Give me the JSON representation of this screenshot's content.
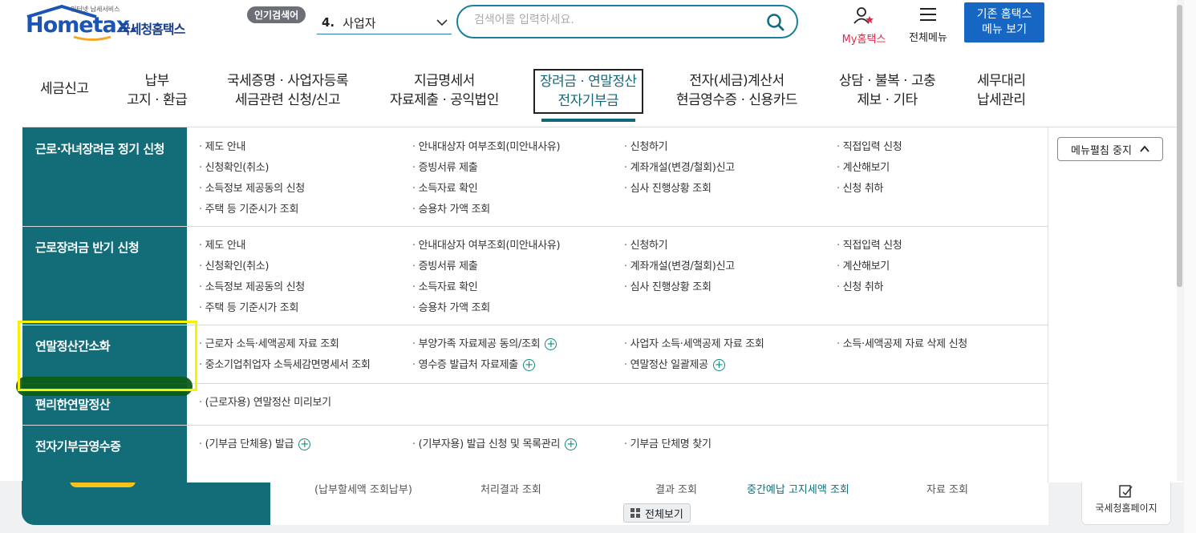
{
  "header": {
    "logo_small": "인터넷 납세서비스",
    "logo_main": "Hometax.",
    "logo_sub": "국세청홈택스",
    "popular_badge": "인기검색어",
    "popular_rank": "4.",
    "popular_term": "사업자",
    "search_placeholder": "검색어를 입력하세요.",
    "myhome_label": "My홈택스",
    "allmenu_label": "전체메뉴",
    "legacy_line1": "기존 홈택스",
    "legacy_line2": "메뉴 보기"
  },
  "gnb": [
    {
      "line1": "세금신고",
      "line2": ""
    },
    {
      "line1": "납부",
      "line2": "고지 · 환급"
    },
    {
      "line1": "국세증명 · 사업자등록",
      "line2": "세금관련 신청/신고"
    },
    {
      "line1": "지급명세서",
      "line2": "자료제출 · 공익법인"
    },
    {
      "line1": "장려금 · 연말정산",
      "line2": "전자기부금"
    },
    {
      "line1": "전자(세금)계산서",
      "line2": "현금영수증 · 신용카드"
    },
    {
      "line1": "상담 · 불복 · 고충",
      "line2": "제보 · 기타"
    },
    {
      "line1": "세무대리",
      "line2": "납세관리"
    }
  ],
  "menu_stop": "메뉴펼침 중지",
  "sections": [
    {
      "title": "근로·자녀장려금 정기 신청",
      "links": [
        [
          "제도 안내",
          "안내대상자 여부조회(미안내사유)",
          "신청하기",
          "직접입력 신청"
        ],
        [
          "신청확인(취소)",
          "증빙서류 제출",
          "계좌개설(변경/철회)신고",
          "계산해보기"
        ],
        [
          "소득정보 제공동의 신청",
          "소득자료 확인",
          "심사 진행상황 조회",
          "신청 취하"
        ],
        [
          "주택 등 기준시가 조회",
          "승용차 가액 조회",
          "",
          ""
        ]
      ]
    },
    {
      "title": "근로장려금 반기 신청",
      "links": [
        [
          "제도 안내",
          "안내대상자 여부조회(미안내사유)",
          "신청하기",
          "직접입력 신청"
        ],
        [
          "신청확인(취소)",
          "증빙서류 제출",
          "계좌개설(변경/철회)신고",
          "계산해보기"
        ],
        [
          "소득정보 제공동의 신청",
          "소득자료 확인",
          "심사 진행상황 조회",
          "신청 취하"
        ],
        [
          "주택 등 기준시가 조회",
          "승용차 가액 조회",
          "",
          ""
        ]
      ]
    },
    {
      "title": "연말정산간소화",
      "links": [
        [
          "근로자 소득·세액공제 자료 조회",
          "부양가족 자료제공 동의/조회",
          "사업자 소득·세액공제 자료 조회",
          "소득·세액공제 자료 삭제 신청"
        ],
        [
          "중소기업취업자 소득세감면명세서 조회",
          "영수증 발급처 자료제출",
          "연말정산 일괄제공",
          ""
        ]
      ]
    },
    {
      "title": "편리한연말정산",
      "links": [
        [
          "(근로자용) 연말정산 미리보기",
          "",
          "",
          ""
        ]
      ]
    },
    {
      "title": "전자기부금영수증",
      "links": [
        [
          "(기부금 단체용) 발급",
          "(기부자용) 발급 신청 및 목록관리",
          "기부금 단체명 찾기",
          ""
        ]
      ]
    }
  ],
  "bottom": {
    "tabs": [
      "(납부할세액 조회납부)",
      "처리결과 조회",
      "결과 조회",
      "중간예납 고지세액 조회",
      "자료 조회"
    ],
    "view_all": "전체보기",
    "nts_page": "국세청홈페이지"
  },
  "colors": {
    "teal": "#126d78",
    "blue": "#1667c3",
    "highlight": "#f6f200"
  }
}
